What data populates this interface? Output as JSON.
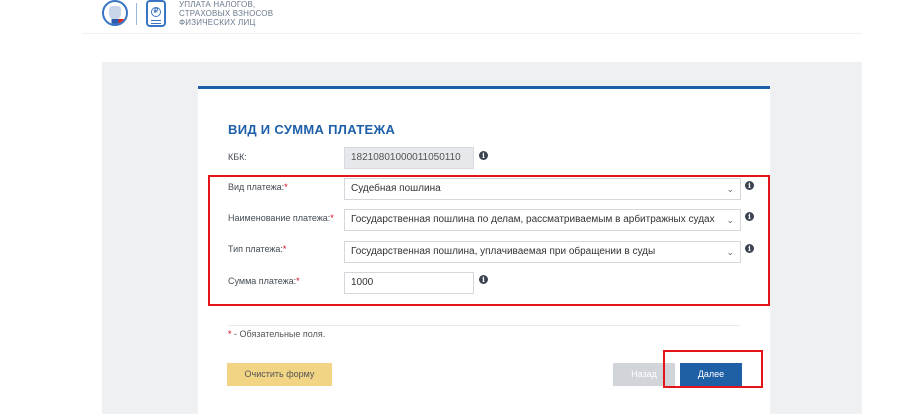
{
  "header": {
    "service_name_lines": [
      "УПЛАТА НАЛОГОВ,",
      "СТРАХОВЫХ ВЗНОСОВ",
      "ФИЗИЧЕСКИХ ЛИЦ"
    ],
    "logo_coin_symbol": "₽"
  },
  "form": {
    "title": "ВИД И СУММА ПЛАТЕЖА",
    "kbk": {
      "label": "КБК:",
      "value": "18210801000011050110"
    },
    "payment_kind": {
      "label": "Вид платежа:",
      "required_mark": "*",
      "value": "Судебная пошлина"
    },
    "payment_name": {
      "label": "Наименование платежа:",
      "required_mark": "*",
      "value": "Государственная пошлина по делам, рассматриваемым в арбитражных судах"
    },
    "payment_type": {
      "label": "Тип платежа:",
      "required_mark": "*",
      "value": "Государственная пошлина, уплачиваемая при обращении в суды"
    },
    "amount": {
      "label": "Сумма платежа:",
      "required_mark": "*",
      "value": "1000"
    },
    "required_note": {
      "mark": "*",
      "text": " - Обязательные поля."
    }
  },
  "buttons": {
    "clear": "Очистить форму",
    "back": "Назад",
    "next": "Далее"
  },
  "icons": {
    "info": "i",
    "chevron": "⌄"
  },
  "colors": {
    "accent": "#1d5fa8",
    "clear_button": "#f1d585",
    "back_button": "#d1d4d8",
    "next_button": "#1e5fa6",
    "highlight": "#e3141a",
    "required": "#d0021b"
  }
}
